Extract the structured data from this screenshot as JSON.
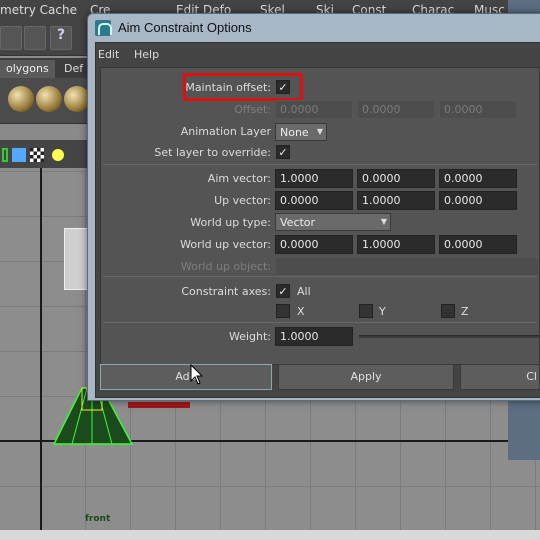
{
  "background": {
    "menu": [
      "metry Cache",
      "Cre",
      "Edit Defo",
      "Skel",
      "Ski",
      "Const",
      "Charac",
      "Musc"
    ],
    "tabs": [
      "olygons",
      "Def"
    ],
    "viewport_label": "front"
  },
  "dialog": {
    "title": "Aim Constraint Options",
    "menu": [
      "Edit",
      "Help"
    ],
    "maintain_offset": {
      "label": "Maintain offset:",
      "checked": "✓"
    },
    "offset": {
      "label": "Offset:",
      "values": [
        "0.0000",
        "0.0000",
        "0.0000"
      ]
    },
    "animation_layer": {
      "label": "Animation Layer",
      "value": "None"
    },
    "set_layer": {
      "label": "Set layer to override:",
      "checked": "✓"
    },
    "aim_vector": {
      "label": "Aim vector:",
      "values": [
        "1.0000",
        "0.0000",
        "0.0000"
      ]
    },
    "up_vector": {
      "label": "Up vector:",
      "values": [
        "0.0000",
        "1.0000",
        "0.0000"
      ]
    },
    "world_up_type": {
      "label": "World up type:",
      "value": "Vector"
    },
    "world_up_vector": {
      "label": "World up vector:",
      "values": [
        "0.0000",
        "1.0000",
        "0.0000"
      ]
    },
    "world_up_object": {
      "label": "World up object:"
    },
    "constraint_axes": {
      "label": "Constraint axes:",
      "all_label": "All",
      "all_checked": "✓",
      "axes": [
        "X",
        "Y",
        "Z"
      ]
    },
    "weight": {
      "label": "Weight:",
      "value": "1.0000"
    },
    "buttons": {
      "add": "Add",
      "apply": "Apply",
      "close": "Cl"
    }
  },
  "colors": {
    "highlight": "#e01010",
    "field_bg": "#2b2b2b",
    "panel_bg": "#545454"
  }
}
